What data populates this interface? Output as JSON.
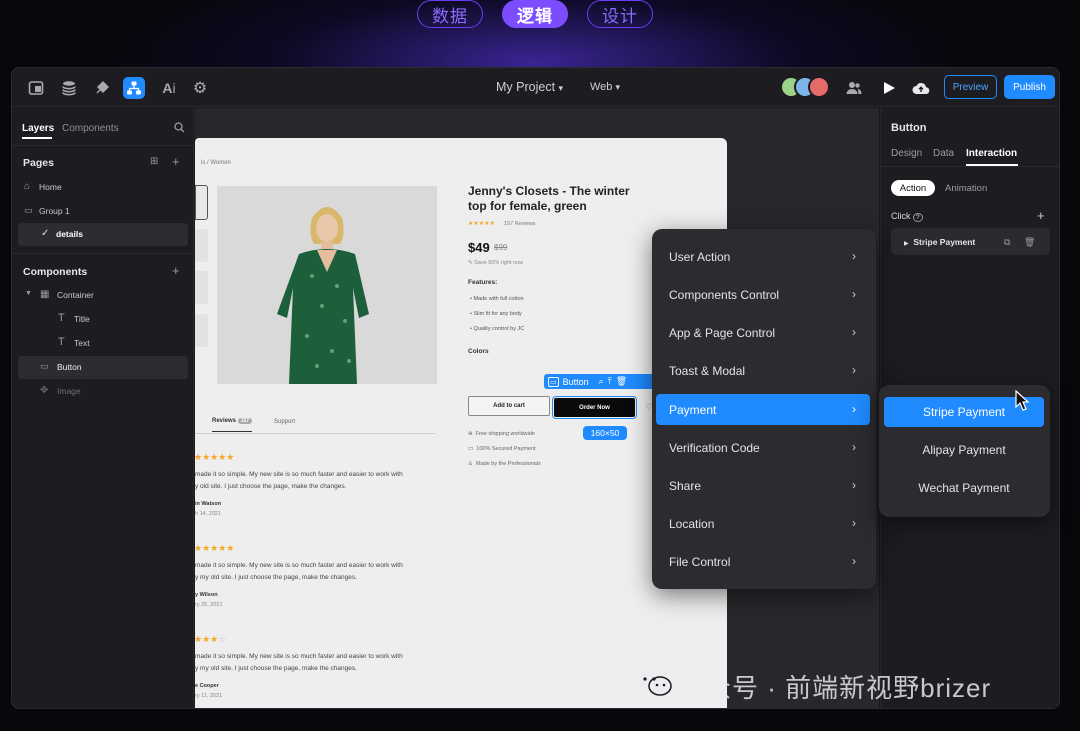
{
  "top_tabs": [
    {
      "label": "数据",
      "active": false
    },
    {
      "label": "逻辑",
      "active": true
    },
    {
      "label": "设计",
      "active": false
    }
  ],
  "toolbar": {
    "icons": [
      "pages-icon",
      "database-icon",
      "plugin-icon",
      "logic-tree-icon",
      "ai-icon",
      "gear-icon"
    ],
    "project_name": "My Project",
    "platform": "Web",
    "preview_label": "Preview",
    "publish_label": "Publish"
  },
  "left_panel": {
    "tabs": [
      "Layers",
      "Components"
    ],
    "pages_title": "Pages",
    "pages": [
      "Home",
      "Group 1",
      "details"
    ],
    "components_title": "Components",
    "layers": [
      "Container",
      "Title",
      "Text",
      "Button",
      "Image"
    ]
  },
  "product": {
    "breadcrumb": "ls / Women",
    "title_line1": "Jenny's Closets - The winter",
    "title_line2": "top for female, green",
    "stars": "★★★★★",
    "reviews_count": "157 Reviews",
    "price": "$49",
    "old_price": "$99",
    "save_text": "Save 50% right now",
    "features_title": "Features:",
    "features": [
      "Made with full cotton",
      "Slim fit for any body",
      "Quality control by JC"
    ],
    "colors_title": "Colors",
    "swatch_colors": [
      "#1f8f4d",
      "#e8641c",
      "#6a6ef0",
      "#3a3f4a"
    ],
    "add_to_cart": "Add to cart",
    "order_now": "Order Now",
    "perks": [
      "Free shipping worldwide",
      "100% Secured Payment",
      "Made by the Professionals"
    ],
    "tabs": [
      "Reviews",
      "Support"
    ],
    "reviews_badge": "157",
    "reviews": [
      {
        "stars": "★★★★★",
        "line1": "made it so simple. My new site is so much faster and easier to work with",
        "line2": "y old site. I just choose the page, make the changes.",
        "name": "in Watson",
        "date": "h 14, 2021"
      },
      {
        "stars": "★★★★★",
        "line1": "made it so simple. My new site is so much faster and easier to work with",
        "line2": "y my old site. I just choose the page, make the changes.",
        "name": "y Wilson",
        "date": "ry 25, 2021"
      },
      {
        "stars": "★★★",
        "line1": "made it so simple. My new site is so much faster and easier to work with",
        "line2": "y my old site. I just choose the page, make the changes.",
        "name": "e Cooper",
        "date": "ry 11, 2021"
      }
    ]
  },
  "selection": {
    "label": "Button",
    "size": "160×50"
  },
  "right_panel": {
    "title": "Button",
    "tabs": [
      "Design",
      "Data",
      "Interaction"
    ],
    "active_tab": "Interaction",
    "subtabs": [
      "Action",
      "Animation"
    ],
    "click_label": "Click",
    "action_item": "Stripe Payment"
  },
  "context_menu": {
    "items": [
      "User Action",
      "Components Control",
      "App & Page Control",
      "Toast & Modal",
      "Payment",
      "Verification Code",
      "Share",
      "Location",
      "File Control"
    ],
    "active": "Payment"
  },
  "submenu": {
    "items": [
      "Stripe Payment",
      "Alipay Payment",
      "Wechat Payment"
    ],
    "active": "Stripe Payment"
  },
  "watermark": "公众号 · 前端新视野brizer",
  "colors": {
    "accent": "#1f8bff",
    "tab_purple": "#7b4dff"
  }
}
